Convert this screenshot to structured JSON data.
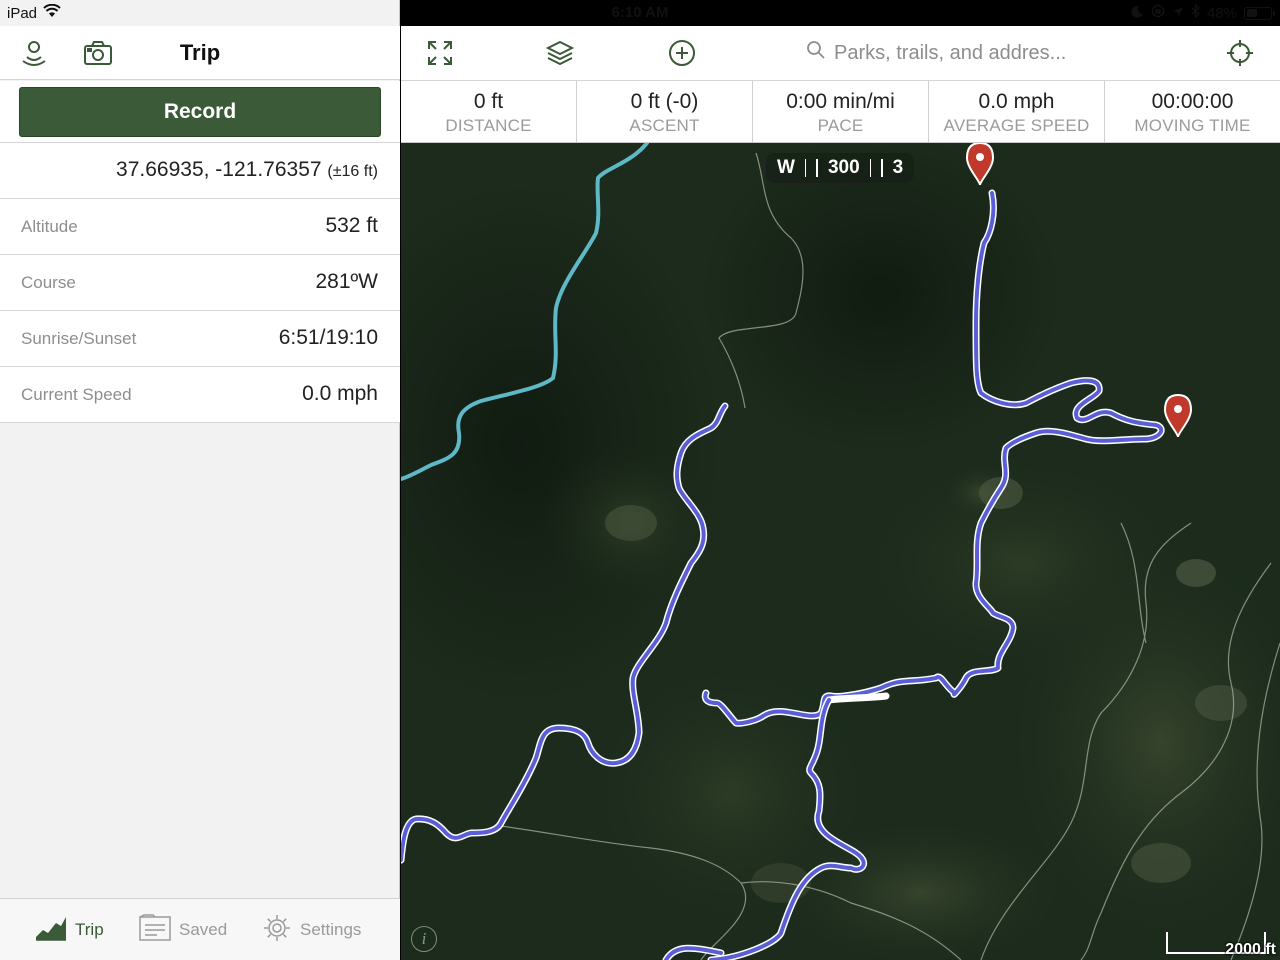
{
  "status_bar": {
    "device": "iPad",
    "time": "6:10 AM",
    "battery_percent": "48%",
    "battery_level": 0.48
  },
  "sidebar": {
    "title": "Trip",
    "record_label": "Record",
    "coordinates": "37.66935, -121.76357",
    "accuracy": "(±16 ft)",
    "rows": [
      {
        "label": "Altitude",
        "value": "532 ft"
      },
      {
        "label": "Course",
        "value": "281ºW"
      },
      {
        "label": "Sunrise/Sunset",
        "value": "6:51/19:10"
      },
      {
        "label": "Current Speed",
        "value": "0.0 mph"
      }
    ]
  },
  "tabs": [
    {
      "label": "Trip",
      "icon": "chart-icon",
      "active": true
    },
    {
      "label": "Saved",
      "icon": "document-icon",
      "active": false
    },
    {
      "label": "Settings",
      "icon": "gear-icon",
      "active": false
    }
  ],
  "toolbar": {
    "search_placeholder": "Parks, trails, and addres..."
  },
  "stats": [
    {
      "value": "0 ft",
      "label": "DISTANCE"
    },
    {
      "value": "0 ft (-0)",
      "label": "ASCENT"
    },
    {
      "value": "0:00 min/mi",
      "label": "PACE"
    },
    {
      "value": "0.0 mph",
      "label": "AVERAGE SPEED"
    },
    {
      "value": "00:00:00",
      "label": "MOVING TIME"
    }
  ],
  "map": {
    "compass": {
      "heading": "W",
      "degrees": "300",
      "next": "3"
    },
    "scale_label": "2000 ft",
    "info_symbol": "i",
    "colors": {
      "trail": "#5a5fd8",
      "water": "#5fb8c6",
      "pin": "#c0392b",
      "accent_green": "#3b5a38"
    }
  }
}
